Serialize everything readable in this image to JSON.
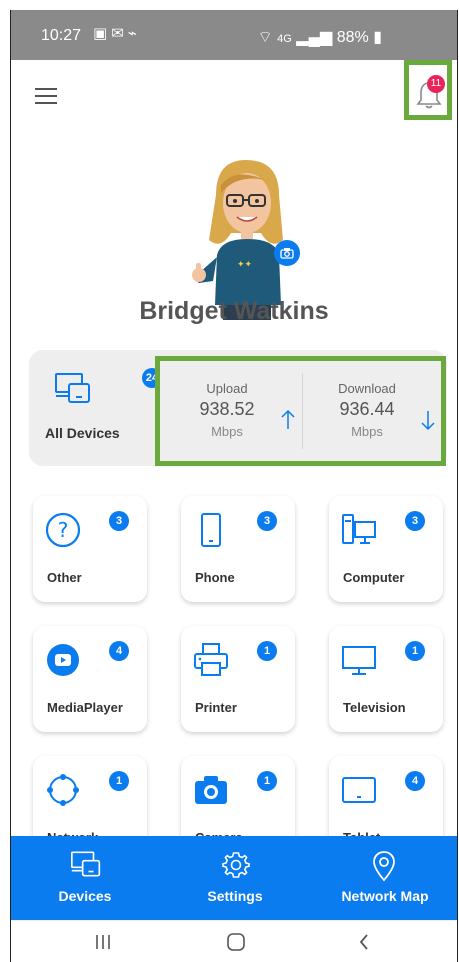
{
  "status_bar": {
    "time": "10:27",
    "icons_left": [
      "image-icon",
      "message-icon",
      "vpn-icon"
    ],
    "network": "4G",
    "battery": "88%"
  },
  "header": {
    "notifications_count": "11"
  },
  "profile": {
    "name": "Bridget Watkins"
  },
  "stats": {
    "all_devices_label": "All Devices",
    "all_devices_count": "24",
    "upload": {
      "label": "Upload",
      "value": "938.52",
      "unit": "Mbps"
    },
    "download": {
      "label": "Download",
      "value": "936.44",
      "unit": "Mbps"
    }
  },
  "categories": [
    {
      "label": "Other",
      "count": "3"
    },
    {
      "label": "Phone",
      "count": "3"
    },
    {
      "label": "Computer",
      "count": "3"
    },
    {
      "label": "MediaPlayer",
      "count": "4"
    },
    {
      "label": "Printer",
      "count": "1"
    },
    {
      "label": "Television",
      "count": "1"
    },
    {
      "label": "Network",
      "count": "1"
    },
    {
      "label": "Camera",
      "count": "1"
    },
    {
      "label": "Tablet",
      "count": "4"
    }
  ],
  "bottom_nav": [
    {
      "label": "Devices"
    },
    {
      "label": "Settings"
    },
    {
      "label": "Network Map"
    }
  ],
  "colors": {
    "accent": "#0a7cf0",
    "highlight": "#6aaa3c",
    "badge_red": "#e8245b"
  }
}
